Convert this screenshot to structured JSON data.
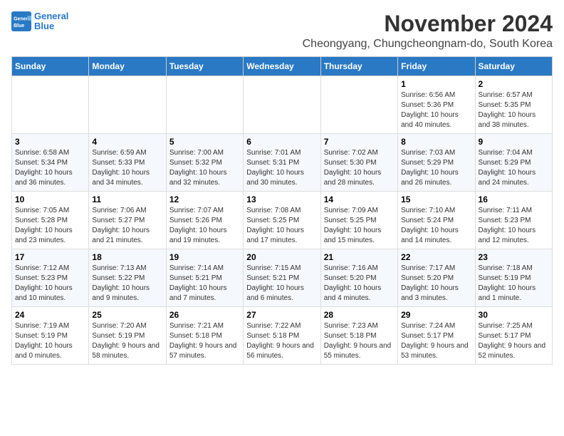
{
  "header": {
    "logo_line1": "General",
    "logo_line2": "Blue",
    "month": "November 2024",
    "location": "Cheongyang, Chungcheongnam-do, South Korea"
  },
  "weekdays": [
    "Sunday",
    "Monday",
    "Tuesday",
    "Wednesday",
    "Thursday",
    "Friday",
    "Saturday"
  ],
  "weeks": [
    [
      {
        "day": "",
        "info": ""
      },
      {
        "day": "",
        "info": ""
      },
      {
        "day": "",
        "info": ""
      },
      {
        "day": "",
        "info": ""
      },
      {
        "day": "",
        "info": ""
      },
      {
        "day": "1",
        "info": "Sunrise: 6:56 AM\nSunset: 5:36 PM\nDaylight: 10 hours and 40 minutes."
      },
      {
        "day": "2",
        "info": "Sunrise: 6:57 AM\nSunset: 5:35 PM\nDaylight: 10 hours and 38 minutes."
      }
    ],
    [
      {
        "day": "3",
        "info": "Sunrise: 6:58 AM\nSunset: 5:34 PM\nDaylight: 10 hours and 36 minutes."
      },
      {
        "day": "4",
        "info": "Sunrise: 6:59 AM\nSunset: 5:33 PM\nDaylight: 10 hours and 34 minutes."
      },
      {
        "day": "5",
        "info": "Sunrise: 7:00 AM\nSunset: 5:32 PM\nDaylight: 10 hours and 32 minutes."
      },
      {
        "day": "6",
        "info": "Sunrise: 7:01 AM\nSunset: 5:31 PM\nDaylight: 10 hours and 30 minutes."
      },
      {
        "day": "7",
        "info": "Sunrise: 7:02 AM\nSunset: 5:30 PM\nDaylight: 10 hours and 28 minutes."
      },
      {
        "day": "8",
        "info": "Sunrise: 7:03 AM\nSunset: 5:29 PM\nDaylight: 10 hours and 26 minutes."
      },
      {
        "day": "9",
        "info": "Sunrise: 7:04 AM\nSunset: 5:29 PM\nDaylight: 10 hours and 24 minutes."
      }
    ],
    [
      {
        "day": "10",
        "info": "Sunrise: 7:05 AM\nSunset: 5:28 PM\nDaylight: 10 hours and 23 minutes."
      },
      {
        "day": "11",
        "info": "Sunrise: 7:06 AM\nSunset: 5:27 PM\nDaylight: 10 hours and 21 minutes."
      },
      {
        "day": "12",
        "info": "Sunrise: 7:07 AM\nSunset: 5:26 PM\nDaylight: 10 hours and 19 minutes."
      },
      {
        "day": "13",
        "info": "Sunrise: 7:08 AM\nSunset: 5:25 PM\nDaylight: 10 hours and 17 minutes."
      },
      {
        "day": "14",
        "info": "Sunrise: 7:09 AM\nSunset: 5:25 PM\nDaylight: 10 hours and 15 minutes."
      },
      {
        "day": "15",
        "info": "Sunrise: 7:10 AM\nSunset: 5:24 PM\nDaylight: 10 hours and 14 minutes."
      },
      {
        "day": "16",
        "info": "Sunrise: 7:11 AM\nSunset: 5:23 PM\nDaylight: 10 hours and 12 minutes."
      }
    ],
    [
      {
        "day": "17",
        "info": "Sunrise: 7:12 AM\nSunset: 5:23 PM\nDaylight: 10 hours and 10 minutes."
      },
      {
        "day": "18",
        "info": "Sunrise: 7:13 AM\nSunset: 5:22 PM\nDaylight: 10 hours and 9 minutes."
      },
      {
        "day": "19",
        "info": "Sunrise: 7:14 AM\nSunset: 5:21 PM\nDaylight: 10 hours and 7 minutes."
      },
      {
        "day": "20",
        "info": "Sunrise: 7:15 AM\nSunset: 5:21 PM\nDaylight: 10 hours and 6 minutes."
      },
      {
        "day": "21",
        "info": "Sunrise: 7:16 AM\nSunset: 5:20 PM\nDaylight: 10 hours and 4 minutes."
      },
      {
        "day": "22",
        "info": "Sunrise: 7:17 AM\nSunset: 5:20 PM\nDaylight: 10 hours and 3 minutes."
      },
      {
        "day": "23",
        "info": "Sunrise: 7:18 AM\nSunset: 5:19 PM\nDaylight: 10 hours and 1 minute."
      }
    ],
    [
      {
        "day": "24",
        "info": "Sunrise: 7:19 AM\nSunset: 5:19 PM\nDaylight: 10 hours and 0 minutes."
      },
      {
        "day": "25",
        "info": "Sunrise: 7:20 AM\nSunset: 5:19 PM\nDaylight: 9 hours and 58 minutes."
      },
      {
        "day": "26",
        "info": "Sunrise: 7:21 AM\nSunset: 5:18 PM\nDaylight: 9 hours and 57 minutes."
      },
      {
        "day": "27",
        "info": "Sunrise: 7:22 AM\nSunset: 5:18 PM\nDaylight: 9 hours and 56 minutes."
      },
      {
        "day": "28",
        "info": "Sunrise: 7:23 AM\nSunset: 5:18 PM\nDaylight: 9 hours and 55 minutes."
      },
      {
        "day": "29",
        "info": "Sunrise: 7:24 AM\nSunset: 5:17 PM\nDaylight: 9 hours and 53 minutes."
      },
      {
        "day": "30",
        "info": "Sunrise: 7:25 AM\nSunset: 5:17 PM\nDaylight: 9 hours and 52 minutes."
      }
    ]
  ]
}
